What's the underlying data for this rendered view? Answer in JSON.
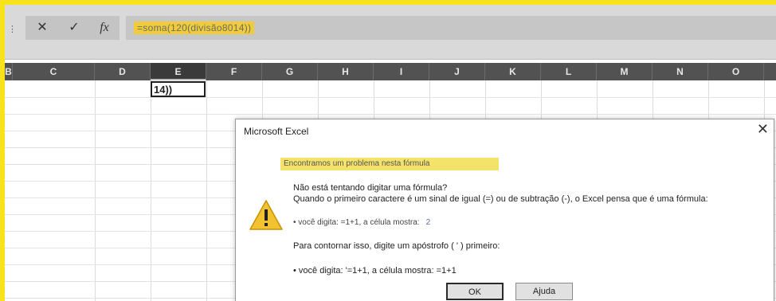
{
  "formula_bar": {
    "cancel_symbol": "✕",
    "enter_symbol": "✓",
    "fx_symbol": "fx",
    "formula": "=soma(120(divisão8014))"
  },
  "columns": [
    "B",
    "C",
    "D",
    "E",
    "F",
    "G",
    "H",
    "I",
    "J",
    "K",
    "L",
    "M",
    "N",
    "O"
  ],
  "active_cell": {
    "column": "E",
    "value": "14))"
  },
  "dialog": {
    "title": "Microsoft Excel",
    "close_symbol": "✕",
    "highlight": "Encontramos um problema nesta fórmula",
    "question": "Não está tentando digitar uma fórmula?",
    "explanation": "Quando o primeiro caractere é um sinal de igual (=) ou de subtração (-), o Excel pensa que é uma fórmula:",
    "example1_prefix": "• você digita:   =1+1, a célula mostra:",
    "example1_value": "2",
    "instruction": "Para contornar isso, digite um apóstrofo ( ' ) primeiro:",
    "example2": "• você digita:  '=1+1, a célula mostra:   =1+1",
    "ok_label": "OK",
    "help_label": "Ajuda"
  }
}
